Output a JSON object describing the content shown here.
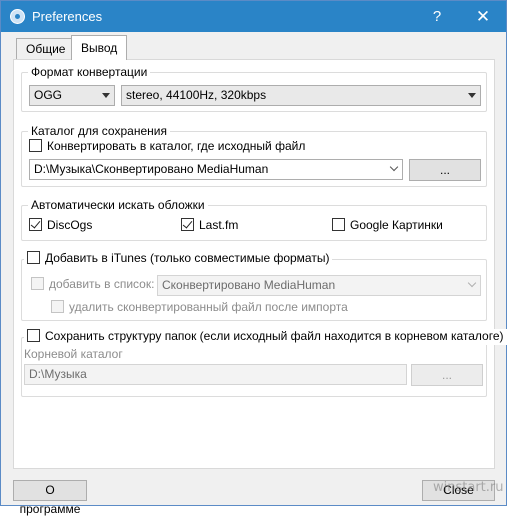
{
  "window": {
    "title": "Preferences",
    "help": "?",
    "close": "✕"
  },
  "tabs": [
    {
      "label": "Общие",
      "active": false
    },
    {
      "label": "Вывод",
      "active": true
    }
  ],
  "format_group": {
    "title": "Формат конвертации",
    "format_value": "OGG",
    "quality_value": "stereo, 44100Hz, 320kbps"
  },
  "output_group": {
    "title": "Каталог для сохранения",
    "convert_to_source_label": "Конвертировать в каталог, где исходный файл",
    "convert_to_source_checked": false,
    "path_value": "D:\\Музыка\\Сконвертировано MediaHuman",
    "browse_label": "..."
  },
  "covers_group": {
    "title": "Автоматически искать обложки",
    "options": [
      {
        "label": "DiscOgs",
        "checked": true
      },
      {
        "label": "Last.fm",
        "checked": true
      },
      {
        "label": "Google Картинки",
        "checked": false
      }
    ]
  },
  "itunes_group": {
    "add_label": "Добавить в iTunes (только совместимые форматы)",
    "add_checked": false,
    "add_to_list_label": "добавить в список:",
    "list_value": "Сконвертировано MediaHuman",
    "delete_after_label": "удалить сконвертированный файл после импорта"
  },
  "structure_group": {
    "keep_structure_label": "Сохранить структуру папок (если исходный файл находится в корневом каталоге)",
    "keep_structure_checked": false,
    "root_label": "Корневой каталог",
    "root_value": "D:\\Музыка",
    "browse_label": "..."
  },
  "footer": {
    "about_label": "О программе",
    "close_label": "Close",
    "watermark": "winstart.ru"
  }
}
